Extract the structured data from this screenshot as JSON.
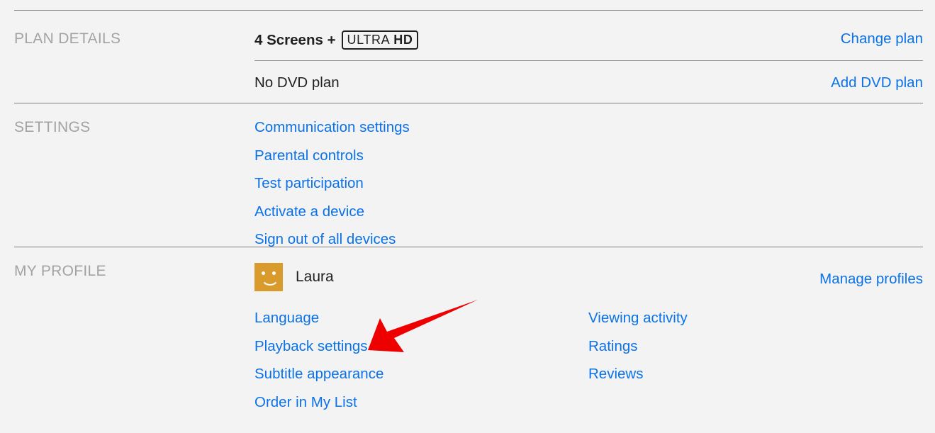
{
  "page": {
    "background_color": "#f3f3f3",
    "link_color": "#0b72e7",
    "label_color": "#a3a3a3",
    "text_color": "#221f1f",
    "avatar_color": "#d89b2c",
    "arrow_color": "#ee0000"
  },
  "plan_details": {
    "label": "PLAN DETAILS",
    "plan_name": "4 Screens +",
    "badge_ultra": "ULTRA",
    "badge_hd": "HD",
    "change_plan_label": "Change plan",
    "dvd_plan_text": "No DVD plan",
    "add_dvd_label": "Add DVD plan"
  },
  "settings": {
    "label": "SETTINGS",
    "links": [
      "Communication settings",
      "Parental controls",
      "Test participation",
      "Activate a device",
      "Sign out of all devices"
    ]
  },
  "my_profile": {
    "label": "MY PROFILE",
    "profile_name": "Laura",
    "manage_profiles_label": "Manage profiles",
    "left_links": [
      "Language",
      "Playback settings",
      "Subtitle appearance",
      "Order in My List"
    ],
    "right_links": [
      "Viewing activity",
      "Ratings",
      "Reviews"
    ]
  },
  "annotation": {
    "arrow_target": "Playback settings"
  }
}
